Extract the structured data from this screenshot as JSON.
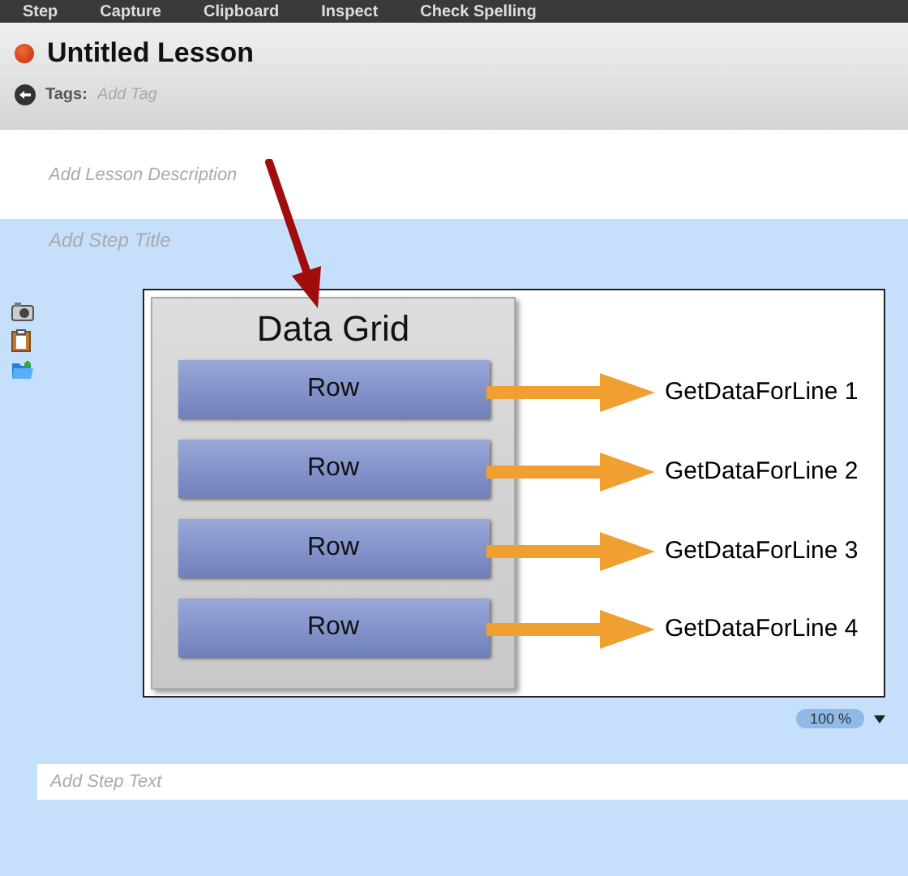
{
  "menu": [
    "Step",
    "Capture",
    "Clipboard",
    "Inspect",
    "Check Spelling"
  ],
  "lesson": {
    "title": "Untitled Lesson",
    "tags_label": "Tags:",
    "tags_placeholder": "Add Tag",
    "description_placeholder": "Add Lesson Description"
  },
  "step": {
    "title_placeholder": "Add Step Title",
    "zoom": "100 %",
    "text_placeholder": "Add Step Text"
  },
  "diagram": {
    "title": "Data Grid",
    "rows": [
      {
        "label": "Row",
        "target": "GetDataForLine 1"
      },
      {
        "label": "Row",
        "target": "GetDataForLine 2"
      },
      {
        "label": "Row",
        "target": "GetDataForLine 3"
      },
      {
        "label": "Row",
        "target": "GetDataForLine 4"
      }
    ]
  }
}
